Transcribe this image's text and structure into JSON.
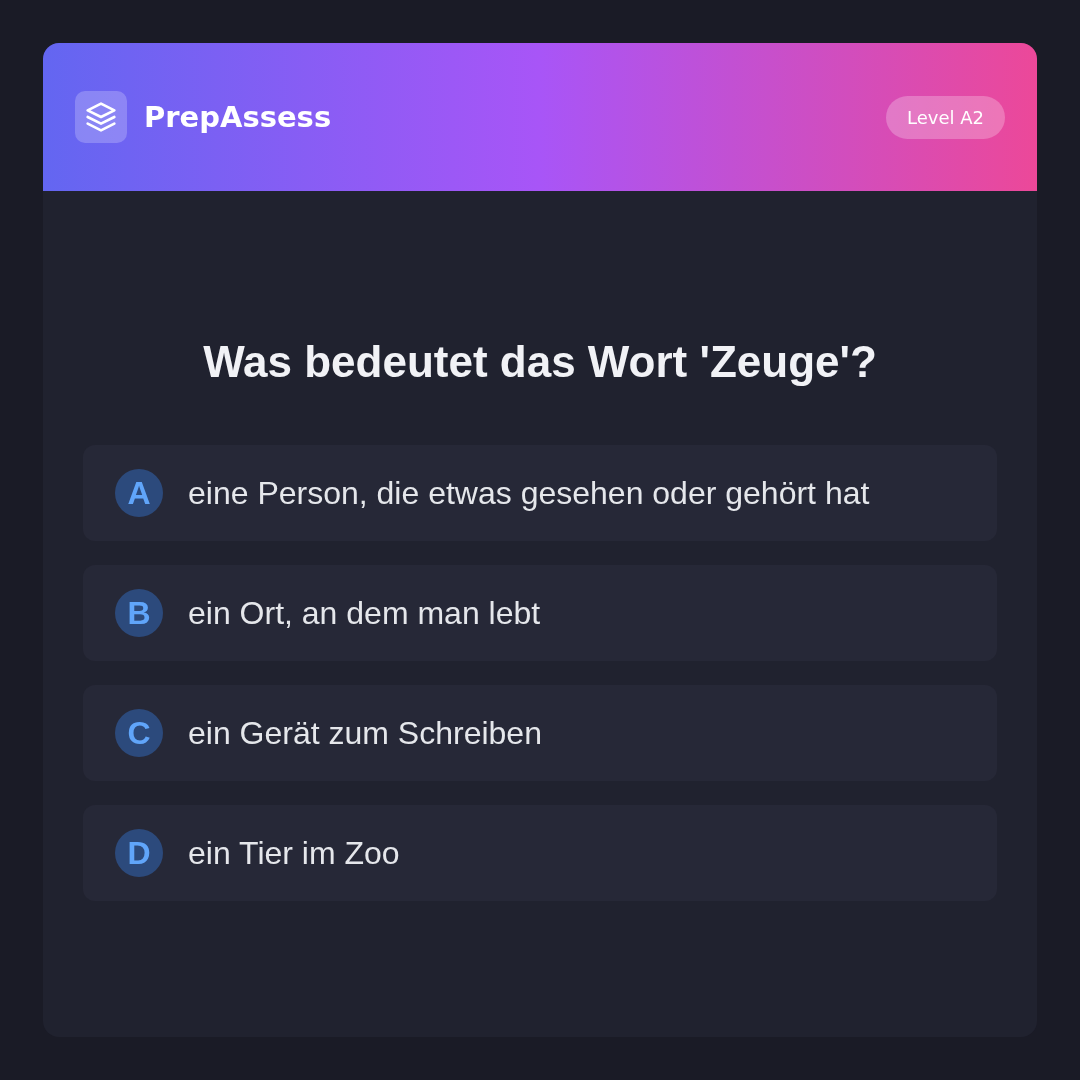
{
  "header": {
    "brand": "PrepAssess",
    "badge": "Level A2"
  },
  "question": "Was bedeutet das Wort 'Zeuge'?",
  "options": [
    {
      "letter": "A",
      "text": "eine Person, die etwas gesehen oder gehört hat"
    },
    {
      "letter": "B",
      "text": "ein Ort, an dem man lebt"
    },
    {
      "letter": "C",
      "text": "ein Gerät zum Schreiben"
    },
    {
      "letter": "D",
      "text": "ein Tier im Zoo"
    }
  ]
}
